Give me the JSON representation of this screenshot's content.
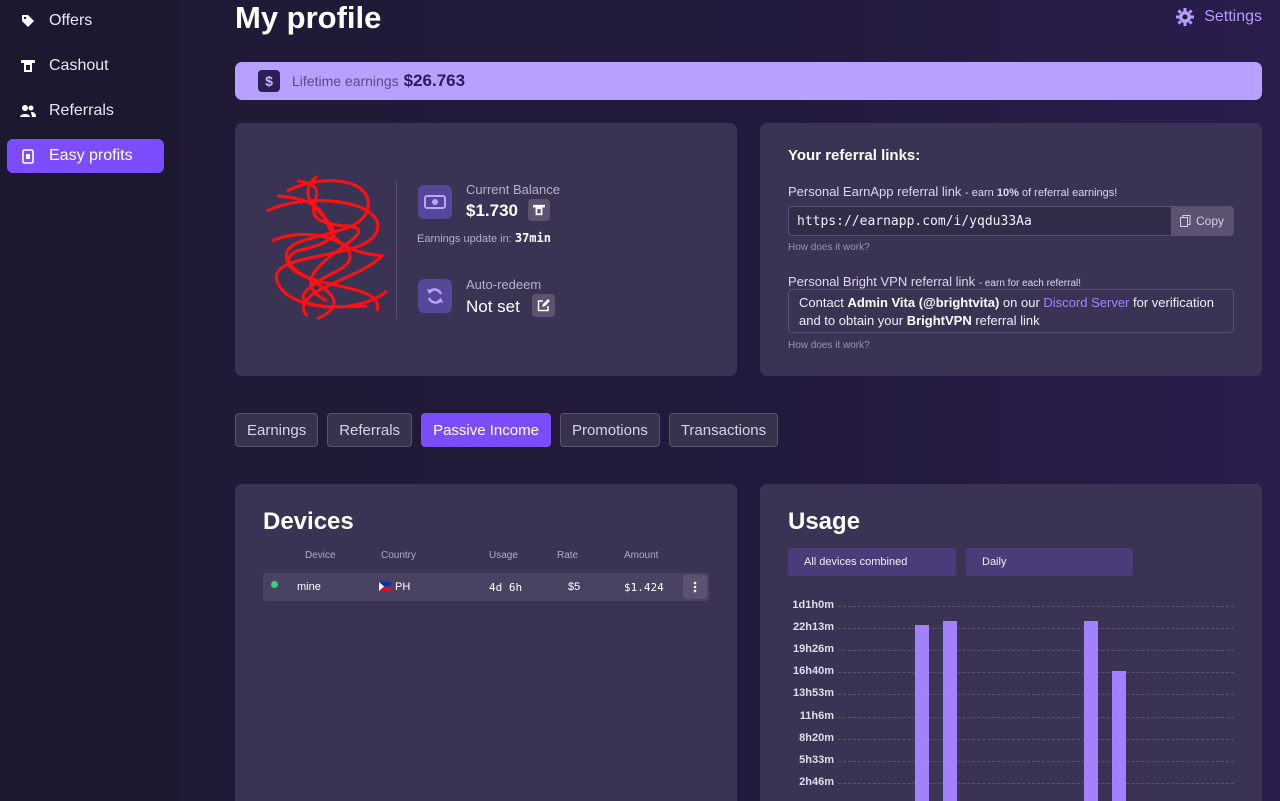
{
  "sidebar": {
    "items": [
      {
        "label": "Offers",
        "icon": "tag-icon"
      },
      {
        "label": "Cashout",
        "icon": "cashout-icon"
      },
      {
        "label": "Referrals",
        "icon": "users-icon"
      },
      {
        "label": "Easy profits",
        "icon": "device-icon",
        "active": true
      }
    ]
  },
  "header": {
    "title": "My profile",
    "settings_label": "Settings"
  },
  "lifetime": {
    "label": "Lifetime earnings",
    "value": "$26.763"
  },
  "profile": {
    "balance_label": "Current Balance",
    "balance_value": "$1.730",
    "update_label": "Earnings update in:",
    "update_value": "37min",
    "redeem_label": "Auto-redeem",
    "redeem_value": "Not set"
  },
  "referral": {
    "title": "Your referral links:",
    "earnapp_label": "Personal EarnApp referral link",
    "earnapp_note_pre": "- earn",
    "earnapp_note_pct": "10%",
    "earnapp_note_post": "of referral earnings!",
    "earnapp_url": "https://earnapp.com/i/yqdu33Aa",
    "copy_label": "Copy",
    "how_label": "How does it work?",
    "vpn_label": "Personal Bright VPN referral link",
    "vpn_note": "- earn for each referral!",
    "vpn_text_1": "Contact",
    "vpn_admin": "Admin Vita (@brightvita)",
    "vpn_text_2": "on our",
    "vpn_discord": "Discord Server",
    "vpn_text_3": "for verification and to obtain your",
    "vpn_brand": "BrightVPN",
    "vpn_text_4": "referral link"
  },
  "tabs": [
    {
      "label": "Earnings"
    },
    {
      "label": "Referrals"
    },
    {
      "label": "Passive Income",
      "active": true
    },
    {
      "label": "Promotions"
    },
    {
      "label": "Transactions"
    }
  ],
  "devices": {
    "title": "Devices",
    "columns": [
      "Device",
      "Country",
      "Usage",
      "Rate",
      "Amount"
    ],
    "rows": [
      {
        "device": "mine",
        "country": "PH",
        "usage": "4d 6h",
        "rate": "$5",
        "amount": "$1.424",
        "status_color": "#2ed67f"
      }
    ]
  },
  "usage": {
    "title": "Usage",
    "select_devices": "All devices combined",
    "select_period": "Daily"
  },
  "chart_data": {
    "type": "bar",
    "title": "",
    "xlabel": "",
    "ylabel": "",
    "y_tick_labels": [
      "1d1h0m",
      "22h13m",
      "19h26m",
      "16h40m",
      "13h53m",
      "11h6m",
      "8h20m",
      "5h33m",
      "2h46m"
    ],
    "ylim_minutes": [
      0,
      1500
    ],
    "grid": true,
    "color": "#a281ff",
    "values_minutes": [
      0,
      0,
      0,
      0,
      0,
      1355,
      1390,
      0,
      0,
      0,
      0,
      1390,
      1010,
      0
    ]
  }
}
